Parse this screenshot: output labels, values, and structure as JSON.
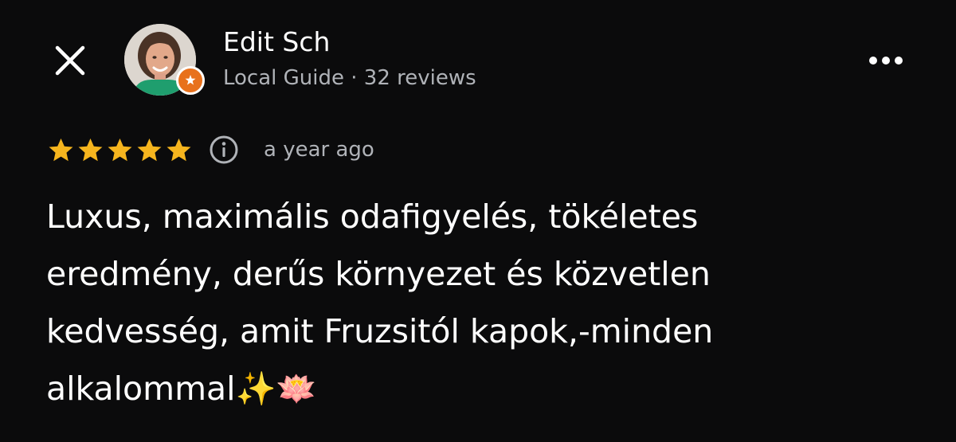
{
  "header": {
    "close_icon": "close-icon",
    "more_icon": "more-horizontal-icon"
  },
  "reviewer": {
    "name": "Edit Sch",
    "meta": "Local Guide · 32 reviews",
    "badge_icon": "local-guide-star-icon",
    "badge_color": "#e8711c"
  },
  "review": {
    "rating": 5,
    "max_rating": 5,
    "star_color": "#f6b51e",
    "date": "a year ago",
    "info_icon": "info-icon",
    "text_lines": [
      "Luxus, maximális odafigyelés, tökéletes",
      "eredmény, derűs környezet és közvetlen",
      "kedvesség, amit Fruzsitól kapok,-minden",
      "alkalommal"
    ],
    "emojis": [
      "✨",
      "🪷"
    ]
  }
}
